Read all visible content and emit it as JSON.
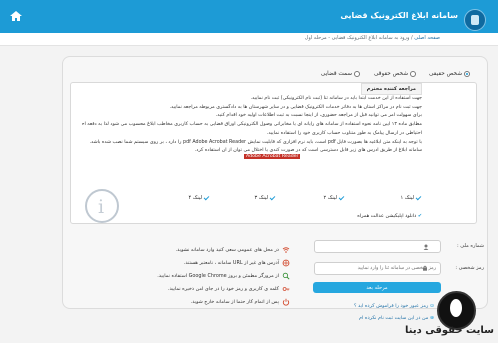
{
  "header": {
    "title": "سامانه ابلاغ الکترونیک قضایی",
    "home_icon": "home-icon",
    "breadcrumb_home": "صفحه اصلی",
    "breadcrumb_rest": "ورود به سامانه ابلاغ الکترونیک قضایی - مرحله اول"
  },
  "person_type": {
    "options": [
      "شخص حقیقی",
      "شخص حقوقی",
      "سمت قضایی"
    ],
    "selected": "شخص حقیقی"
  },
  "notice": {
    "tab_label": "مراجعه کننده محترم",
    "lines": [
      "جهت استفاده از این خدمت ابتدا باید در سامانه ثنا (ثبت نام الکترونیکی) ثبت نام نمایید.",
      "جهت ثبت نام در مراکز استان ها به دفاتر خدمات الکترونیک قضایی و در سایر شهرستان ها به دادگستری مربوطه مراجعه نمایید.",
      "برای سهولت امر می توانید قبل از مراجعه حضوری، از اینجا نسبت به ثبت اطلاعات اولیه خود اقدام کنید.",
      "مطابق ماده ۱۳ آیین نامه نحوه استفاده از سامانه های رایانه ای یا مخابراتی وصول الکترونیکی اوراق قضایی به حساب کاربری مخاطب ابلاغ محسوب می شود لذا به دفعه احتیاطی",
      "احتیاطی در ارسال پیامک به طور متناوب حساب کاربری خود را استفاده نمایید.",
      "با توجه به اینکه متن ابلاغیه ها بصورت فایل pdf است، باید نرم افزاری که قابلیت نمایش pdf Adobe Acrobat Reader را دارد ، بر روی سیستم شما نصب شده باشد.",
      "سامانه ابلاغ از طریق آدرس های زیر قابل دسترسی است که در صورت کندی یا اختلال می توان از آن استفاده کرد."
    ],
    "acrobat_label": "Adobe Acrobat Reader",
    "links": [
      "لینک ۱",
      "لینک ۲",
      "لینک ۳",
      "لینک ۴"
    ],
    "app_download": "دانلود اپلیکیشن عدالت همراه"
  },
  "login": {
    "username_label": "شماره ملی :",
    "username_placeholder": "",
    "password_label": "رمز شخصی :",
    "password_placeholder": "رمز شخصی در سامانه ثنا را وارد نمایید",
    "submit_label": "مرحله بعد",
    "forgot_link": "رمز عبور خود را فراموش کرده اید ؟",
    "register_link": "من در این سایت ثبت نام نکرده ام"
  },
  "tips": [
    {
      "icon": "wifi-icon",
      "text": "در محل های عمومی سعی کنید وارد سامانه نشوید."
    },
    {
      "icon": "globe-icon",
      "text": "آدرس های غیر از URL سامانه ، نامعتبر هستند."
    },
    {
      "icon": "search-icon",
      "text": "از مرورگر مطمئن و بروز Google Chrome استفاده نمایید."
    },
    {
      "icon": "key-icon",
      "text": "کلمه ی کاربری و رمز خود را در جای امن ذخیره نمایید."
    },
    {
      "icon": "power-icon",
      "text": "پس از اتمام کار حتما از سامانه خارج شوید."
    }
  ],
  "watermark": {
    "text": "سایت حقوقی دینا"
  },
  "colors": {
    "accent": "#1d9bd6",
    "button": "#26a7df",
    "alert": "#cd2d2d"
  }
}
